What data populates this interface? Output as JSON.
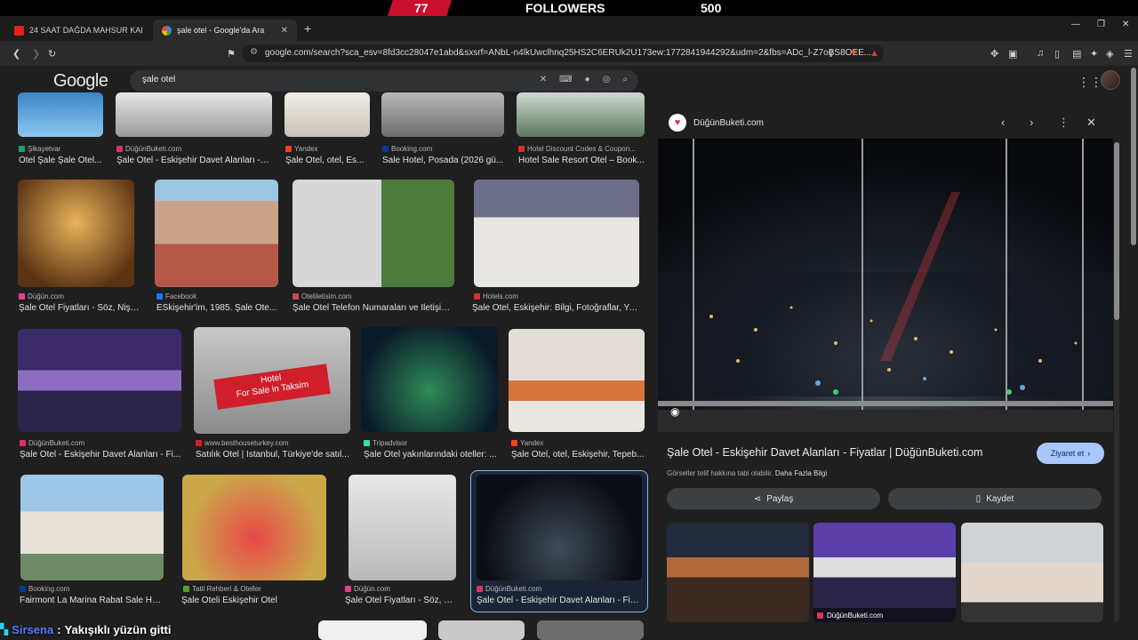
{
  "stream": {
    "left_num": "77",
    "label": "FOLLOWERS",
    "right_num": "500"
  },
  "tabs": [
    {
      "title": "24 SAAT DAĞDA MAHSUR KALMAK",
      "favicon": "youtube-icon"
    },
    {
      "title": "şale otel - Google'da Ara",
      "favicon": "google-icon"
    }
  ],
  "window": {
    "minimize": "—",
    "restore": "❐",
    "close": "✕"
  },
  "address": {
    "url": "google.com/search?sca_esv=8fd3cc28047e1abd&sxsrf=ANbL-n4lkUwclhnq25HS2C6ERUk2U173ew:1772841944292&udm=2&fbs=ADc_l-Z7oBS8OEE..."
  },
  "google": {
    "logo": "Google",
    "query": "şale otel"
  },
  "results": [
    {
      "src": "Şikayetvar",
      "title": "Otel Şale Şale Otel..."
    },
    {
      "src": "DüğünBuketi.com",
      "title": "Şale Otel - Eskişehir Davet Alanları - ..."
    },
    {
      "src": "Yandex",
      "title": "Şale Otel, otel, Es..."
    },
    {
      "src": "Booking.com",
      "title": "Sale Hotel, Posada (2026 gü..."
    },
    {
      "src": "Hotel Discount Codes & Coupon...",
      "title": "Hotel Sale Resort Otel – Book..."
    },
    {
      "src": "Düğün.com",
      "title": "Şale Otel Fiyatları - Söz, Nişa..."
    },
    {
      "src": "Facebook",
      "title": "ESkişehir'im, 1985. Şale Ote..."
    },
    {
      "src": "Oteliletisim.com",
      "title": "Şale Otel Telefon Numaraları ve İletişim ..."
    },
    {
      "src": "Hotels.com",
      "title": "Şale Otel, Eskişehir: Bilgi, Fotoğraflar, Yor..."
    },
    {
      "src": "DüğünBuketi.com",
      "title": "Şale Otel - Eskişehir Davet Alanları - Fi..."
    },
    {
      "src": "www.besthouseturkey.com",
      "title": "Satılık Otel | İstanbul, Türkiye'de satıl..."
    },
    {
      "src": "Tripadvisor",
      "title": "Şale Otel yakınlarındaki oteller: ..."
    },
    {
      "src": "Yandex",
      "title": "Şale Otel, otel, Eskişehir, Tepeb..."
    },
    {
      "src": "Booking.com",
      "title": "Fairmont La Marina Rabat Sale Hot..."
    },
    {
      "src": "Tatil Rehberi & Oteller",
      "title": "Şale Oteli Eskişehir Otel"
    },
    {
      "src": "Düğün.com",
      "title": "Şale Otel Fiyatları - Söz, Ni..."
    },
    {
      "src": "DüğünBuketi.com",
      "title": "Şale Otel - Eskişehir Davet Alanları - Fiya..."
    }
  ],
  "overlay": {
    "hotel_sign": "Hotel",
    "hotel_sign2": "For Sale in Taksim"
  },
  "panel": {
    "source": "DüğünBuketi.com",
    "title": "Şale Otel - Eskişehir Davet Alanları - Fiyatlar | DüğünBuketi.com",
    "copyright": "Görseller telif hakkına tabi olabilir.",
    "more_info": "Daha Fazla Bilgi",
    "visit": "Ziyaret et",
    "share": "Paylaş",
    "save": "Kaydet",
    "thumb_source": "DüğünBuketi.com"
  },
  "chat": {
    "user": "Sirsena",
    "sep": ":",
    "message": "Yakışıklı yüzün gitti"
  }
}
